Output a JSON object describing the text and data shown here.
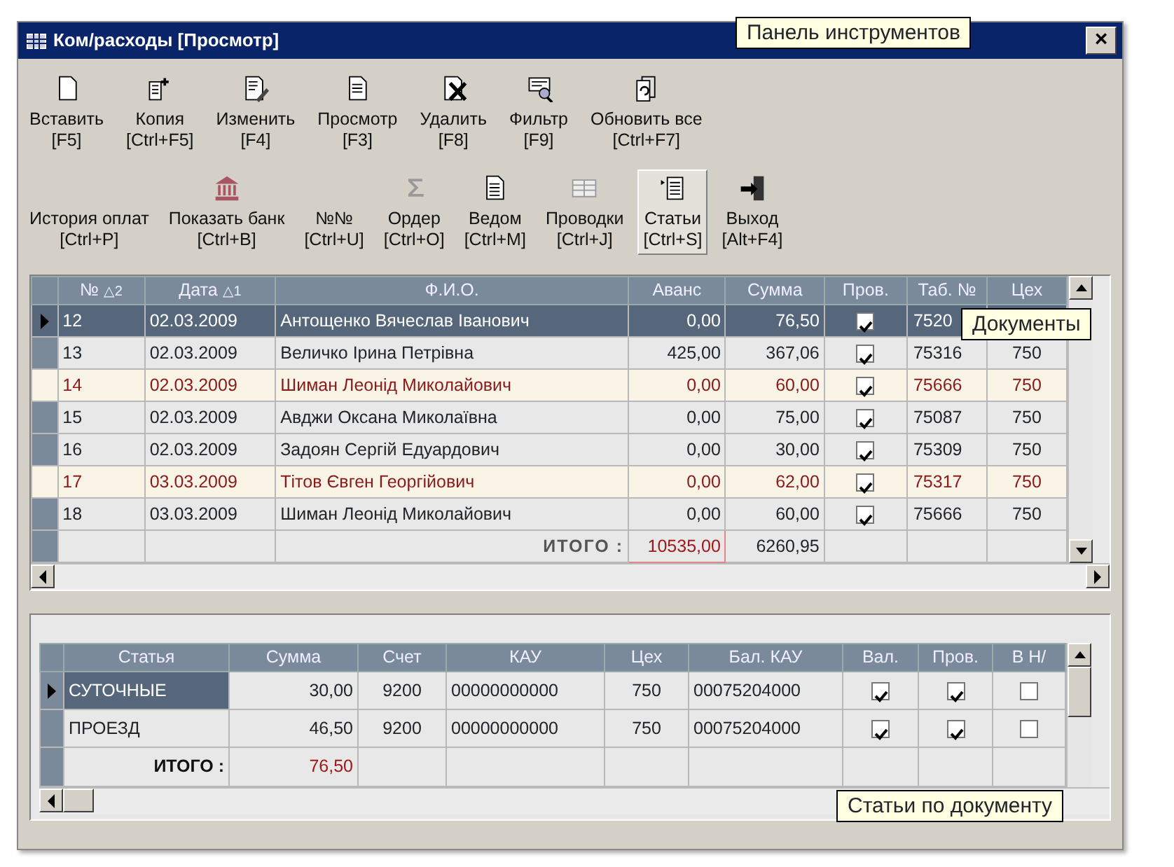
{
  "window": {
    "title": "Ком/расходы [Просмотр]",
    "close": "×"
  },
  "toolbars": [
    {
      "buttons": [
        {
          "label": "Вставить",
          "shortcut": "[F5]",
          "selected": false
        },
        {
          "label": "Копия",
          "shortcut": "[Ctrl+F5]",
          "selected": false
        },
        {
          "label": "Изменить",
          "shortcut": "[F4]",
          "selected": false
        },
        {
          "label": "Просмотр",
          "shortcut": "[F3]",
          "selected": false
        },
        {
          "label": "Удалить",
          "shortcut": "[F8]",
          "selected": false
        },
        {
          "label": "Фильтр",
          "shortcut": "[F9]",
          "selected": false
        },
        {
          "label": "Обновить все",
          "shortcut": "[Ctrl+F7]",
          "selected": false
        }
      ]
    },
    {
      "buttons": [
        {
          "label": "История оплат",
          "shortcut": "[Ctrl+P]",
          "selected": false
        },
        {
          "label": "Показать банк",
          "shortcut": "[Ctrl+B]",
          "selected": false
        },
        {
          "label": "№№",
          "shortcut": "[Ctrl+U]",
          "selected": false
        },
        {
          "label": "Ордер",
          "shortcut": "[Ctrl+O]",
          "selected": false
        },
        {
          "label": "Ведом",
          "shortcut": "[Ctrl+M]",
          "selected": false
        },
        {
          "label": "Проводки",
          "shortcut": "[Ctrl+J]",
          "selected": false
        },
        {
          "label": "Статьи",
          "shortcut": "[Ctrl+S]",
          "selected": true
        },
        {
          "label": "Выход",
          "shortcut": "[Alt+F4]",
          "selected": false
        }
      ]
    }
  ],
  "documents": {
    "columns": [
      {
        "label": "№",
        "sort": "△2"
      },
      {
        "label": "Дата",
        "sort": "△1"
      },
      {
        "label": "Ф.И.О."
      },
      {
        "label": "Аванс"
      },
      {
        "label": "Сумма"
      },
      {
        "label": "Пров."
      },
      {
        "label": "Таб. №"
      },
      {
        "label": "Цех"
      }
    ],
    "rows": [
      {
        "selected": true,
        "highlighted": false,
        "cells": [
          "12",
          "02.03.2009",
          "Антощенко Вячеслав Іванович",
          "0,00",
          "76,50"
        ],
        "checked": true,
        "tab": "7520"
      },
      {
        "selected": false,
        "highlighted": false,
        "cells": [
          "13",
          "02.03.2009",
          "Величко Ірина Петрівна",
          "425,00",
          "367,06"
        ],
        "checked": true,
        "tab": "75316",
        "shop": "750"
      },
      {
        "selected": false,
        "highlighted": true,
        "cells": [
          "14",
          "02.03.2009",
          "Шиман Леонід Миколайович",
          "0,00",
          "60,00"
        ],
        "checked": true,
        "tab": "75666",
        "shop": "750"
      },
      {
        "selected": false,
        "highlighted": false,
        "cells": [
          "15",
          "02.03.2009",
          "Авджи Оксана Миколаївна",
          "0,00",
          "75,00"
        ],
        "checked": true,
        "tab": "75087",
        "shop": "750"
      },
      {
        "selected": false,
        "highlighted": false,
        "cells": [
          "16",
          "02.03.2009",
          "Задоян Сергій Едуардович",
          "0,00",
          "30,00"
        ],
        "checked": true,
        "tab": "75309",
        "shop": "750"
      },
      {
        "selected": false,
        "highlighted": true,
        "cells": [
          "17",
          "03.03.2009",
          "Тітов Євген Георгійович",
          "0,00",
          "62,00"
        ],
        "checked": true,
        "tab": "75317",
        "shop": "750"
      },
      {
        "selected": false,
        "highlighted": false,
        "cells": [
          "18",
          "03.03.2009",
          "Шиман Леонід Миколайович",
          "0,00",
          "60,00"
        ],
        "checked": true,
        "tab": "75666",
        "shop": "750"
      }
    ],
    "total": {
      "label": "ИТОГО :",
      "advance": "10535,00",
      "sum": "6260,95"
    }
  },
  "articles": {
    "columns": [
      "Статья",
      "Сумма",
      "Счет",
      "КАУ",
      "Цех",
      "Бал. КАУ",
      "Вал.",
      "Пров.",
      "В Н/"
    ],
    "rows": [
      {
        "selected": true,
        "cells": [
          "СУТОЧНЫЕ",
          "30,00",
          "9200",
          "00000000000",
          "750",
          "00075204000"
        ],
        "currency": true,
        "posted": true,
        "vat": false
      },
      {
        "selected": false,
        "cells": [
          "ПРОЕЗД",
          "46,50",
          "9200",
          "00000000000",
          "750",
          "00075204000"
        ],
        "currency": true,
        "posted": true,
        "vat": false
      }
    ],
    "total": {
      "label": "ИТОГО :",
      "sum": "76,50"
    }
  },
  "callouts": [
    {
      "text": "Панель инструментов"
    },
    {
      "text": "Документы"
    },
    {
      "text": "Статьи по документу"
    }
  ]
}
